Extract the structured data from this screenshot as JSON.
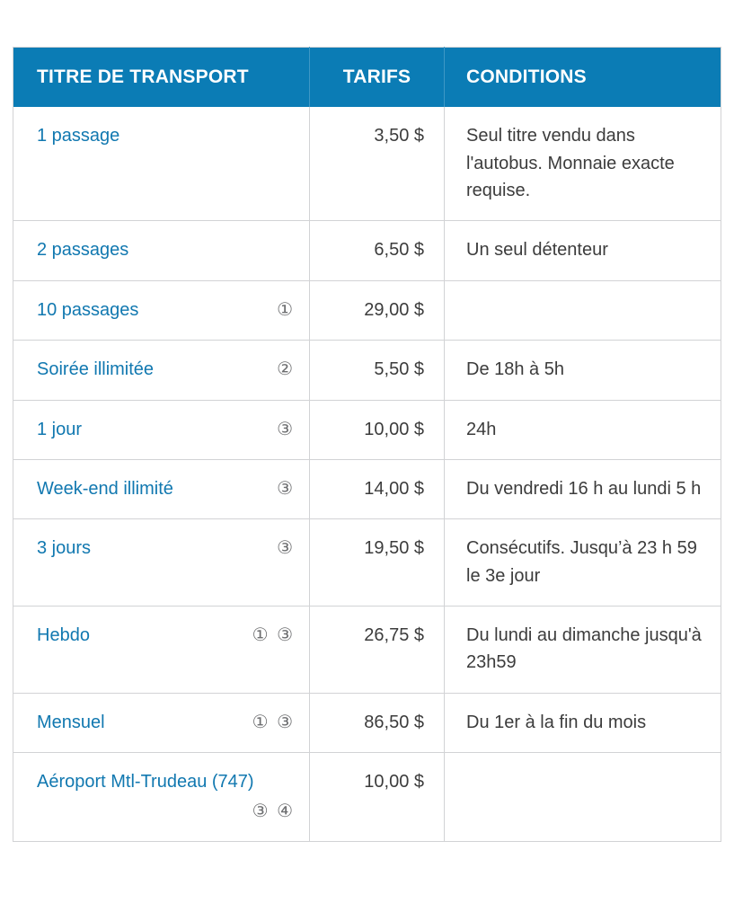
{
  "table": {
    "headers": {
      "titre": "TITRE DE TRANSPORT",
      "tarifs": "TARIFS",
      "conditions": "CONDITIONS"
    },
    "colors": {
      "header_background": "#0b7cb5",
      "header_text": "#ffffff",
      "link_text": "#1178b0",
      "body_text": "#3c3c3c",
      "note_text": "#6d6e70",
      "border": "#d2d3d5",
      "page_background": "#ffffff"
    },
    "rows": [
      {
        "titre": "1 passage",
        "notes": "",
        "notes_below": "",
        "tarif": "3,50 $",
        "conditions": "Seul titre vendu dans l'autobus. Monnaie exacte requise."
      },
      {
        "titre": "2 passages",
        "notes": "",
        "notes_below": "",
        "tarif": "6,50 $",
        "conditions": "Un seul détenteur"
      },
      {
        "titre": "10 passages",
        "notes": "①",
        "notes_below": "",
        "tarif": "29,00 $",
        "conditions": ""
      },
      {
        "titre": "Soirée illimitée",
        "notes": "②",
        "notes_below": "",
        "tarif": "5,50 $",
        "conditions": "De 18h à 5h"
      },
      {
        "titre": "1 jour",
        "notes": "③",
        "notes_below": "",
        "tarif": "10,00 $",
        "conditions": "24h"
      },
      {
        "titre": "Week-end illimité",
        "notes": "③",
        "notes_below": "",
        "tarif": "14,00 $",
        "conditions": "Du vendredi 16 h au lundi 5 h"
      },
      {
        "titre": "3 jours",
        "notes": "③",
        "notes_below": "",
        "tarif": "19,50 $",
        "conditions": "Consécutifs. Jusqu’à 23 h 59 le 3e jour"
      },
      {
        "titre": "Hebdo",
        "notes": "① ③",
        "notes_below": "",
        "tarif": "26,75 $",
        "conditions": "Du lundi au dimanche jusqu'à 23h59"
      },
      {
        "titre": "Mensuel",
        "notes": "① ③",
        "notes_below": "",
        "tarif": "86,50 $",
        "conditions": "Du 1er à la fin du mois"
      },
      {
        "titre": "Aéroport Mtl-Trudeau (747)",
        "notes": "",
        "notes_below": "③ ④",
        "tarif": "10,00 $",
        "conditions": ""
      }
    ]
  }
}
